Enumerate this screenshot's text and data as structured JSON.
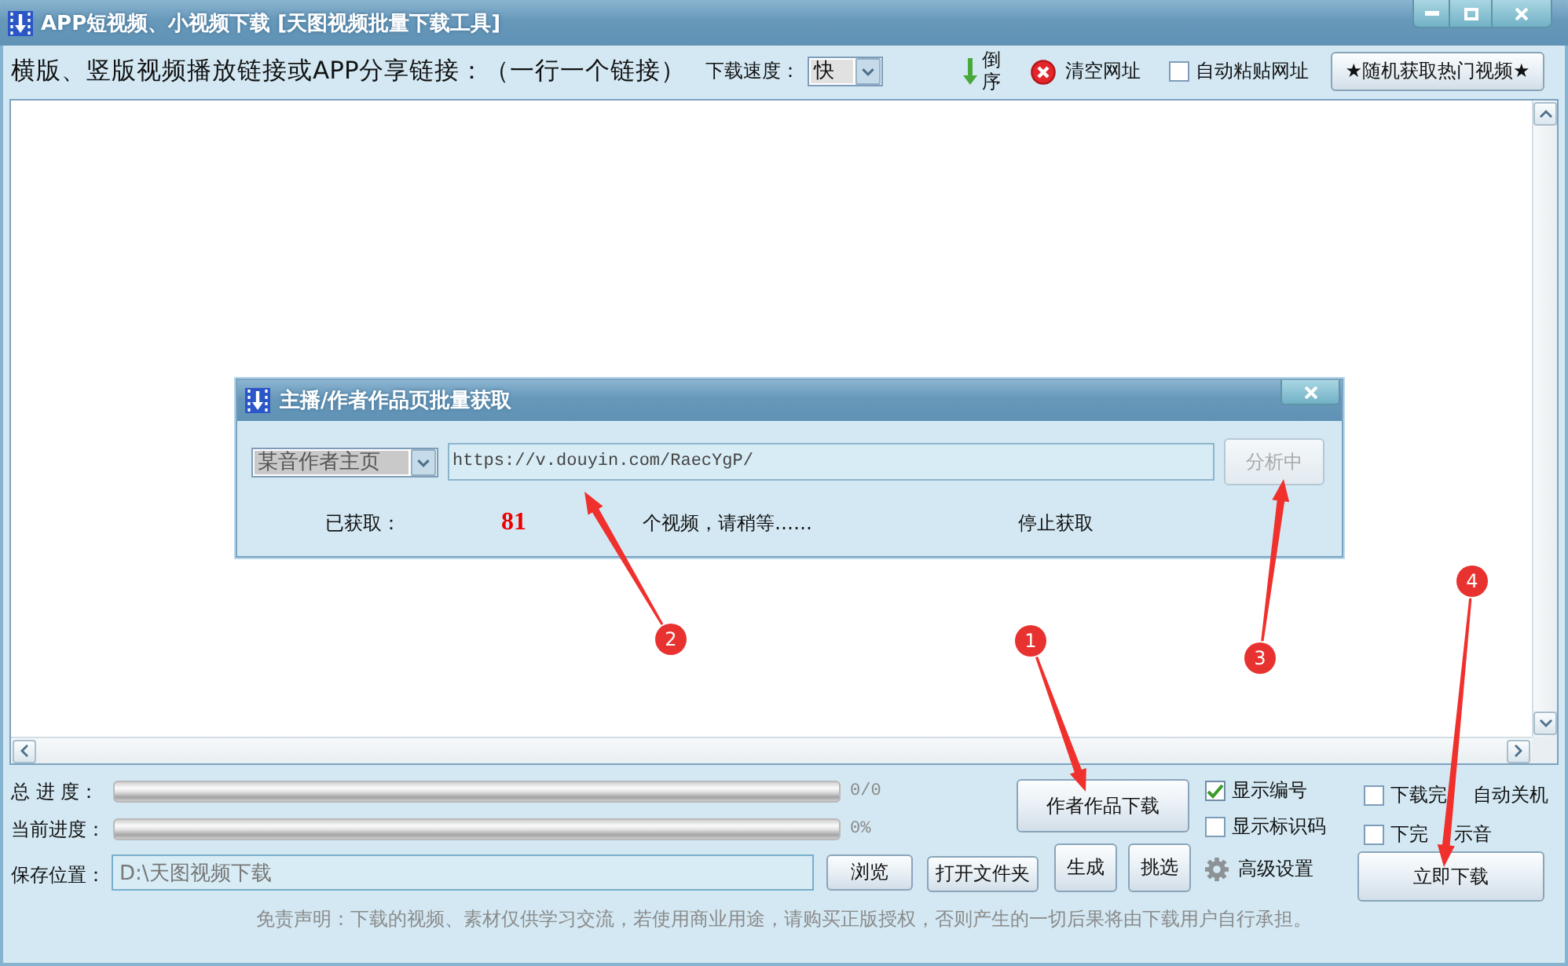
{
  "window": {
    "title": "APP短视频、小视频下载 [天图视频批量下载工具]"
  },
  "toolbar": {
    "link_label": "横版、竖版视频播放链接或APP分享链接：（一行一个链接）",
    "speed_label": "下载速度：",
    "speed_value": "快",
    "reverse_label": "倒序",
    "clear_label": "清空网址",
    "auto_paste": {
      "label": "自动粘贴网址",
      "checked": false
    },
    "random_button": "★随机获取热门视频★"
  },
  "dialog": {
    "title": "主播/作者作品页批量获取",
    "source_select": "某音作者主页",
    "url_value": "https://v.douyin.com/RaecYgP/",
    "analyze_button": {
      "label": "分析中",
      "disabled": true
    },
    "fetched_label": "已获取：",
    "fetched_count": "81",
    "wait_text": "个视频，请稍等……",
    "stop_label": "停止获取"
  },
  "progress": [
    {
      "label": "总 进 度：",
      "reading": "0/0"
    },
    {
      "label": "当前进度：",
      "reading": "0%"
    }
  ],
  "save": {
    "label": "保存位置：",
    "value": "D:\\天图视频下载",
    "browse_button": "浏览",
    "open_folder_button": "打开文件夹"
  },
  "buttons": {
    "author_download": "作者作品下载",
    "generate": "生成",
    "pick": "挑选",
    "advanced": "高级设置",
    "download_now": "立即下载"
  },
  "options": [
    {
      "label": "显示编号",
      "checked": true
    },
    {
      "label": "显示标识码",
      "checked": false
    }
  ],
  "finish_options": [
    {
      "label": "下载完 自动关机",
      "checked": false
    },
    {
      "label": "下完 示音",
      "checked": false
    }
  ],
  "disclaimer": "免责声明：下载的视频、素材仅供学习交流，若使用商业用途，请购买正版授权，否则产生的一切后果将由下载用户自行承担。",
  "annotations": [
    {
      "label": "1"
    },
    {
      "label": "2"
    },
    {
      "label": "3"
    },
    {
      "label": "4"
    }
  ]
}
